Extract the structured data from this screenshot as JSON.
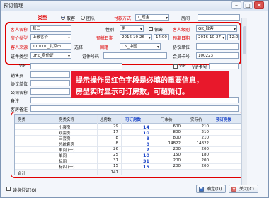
{
  "window": {
    "title": "预订管理",
    "min_label": "–",
    "max_label": "□",
    "close_label": "✕"
  },
  "form": {
    "type_label": "类型",
    "type_opt1": "散客",
    "type_opt2": "团队",
    "pay_label": "付款方式",
    "pay_value": "1_现金",
    "room_label": "房间",
    "room_value": "",
    "guest_name_label": "客人名称",
    "guest_name_value": "张三",
    "gender_label": "性别",
    "gender_value": "男",
    "deposit_label": "保密",
    "guest_class_label": "客人级别",
    "guest_class_value": "GK_散客",
    "guest_type_label": "房价类型",
    "guest_type_value": "上散客价",
    "arrival_label": "预抵日期",
    "arrival_value": "2016-10-26",
    "arrival_time": "14:00",
    "leave_label": "预离日期",
    "leave_value": "2016-10-27",
    "leave_time": "12:00",
    "source_label": "客人来源",
    "source_value": "110000_北京市",
    "source_choose": "选择",
    "country_label": "国籍",
    "country_value": "CN_中国",
    "agent_label": "协议单位",
    "agent_value": "",
    "idtype_label": "证件类型",
    "idtype_value": "0FZ_身份证",
    "idno_label": "证件号码",
    "idno_value": "",
    "card_label": "会员卡号",
    "card_value": "100223",
    "vip_label": "VIP",
    "vip_no_label": "VIP卡号",
    "sales_label": "销售员",
    "phone_label": "电话",
    "agent2_label": "协议单位",
    "company_label": "公司名称",
    "remark_label": "备注",
    "memo_label": "客房备注"
  },
  "banner": {
    "line1": "提示操作员红色字段是必填的重要信息，",
    "line2": "房型实时显示可订房数，可超预订。"
  },
  "grid": {
    "headers": {
      "c0": "房类",
      "c1": "房类名称",
      "c2": "总房数",
      "c3": "可订房数",
      "c4": "门市价",
      "c5": "实际价",
      "c6": "预订房数"
    },
    "rows": [
      {
        "name": "小套房",
        "total": "29",
        "avail": "14",
        "rack": "600",
        "price": "210"
      },
      {
        "name": "双套房",
        "total": "17",
        "avail": "10",
        "rack": "800",
        "price": "210"
      },
      {
        "name": "三套房",
        "total": "8",
        "avail": "8",
        "rack": "800",
        "price": "210"
      },
      {
        "name": "总统套房",
        "total": "8",
        "avail": "8",
        "rack": "14822",
        "price": "14822"
      },
      {
        "name": "单间 (一)",
        "total": "26",
        "avail": "7",
        "rack": "200",
        "price": "200"
      },
      {
        "name": "单间",
        "total": "25",
        "avail": "10",
        "rack": "150",
        "price": "180"
      },
      {
        "name": "标间",
        "total": "37",
        "avail": "31",
        "rack": "200",
        "price": "200"
      },
      {
        "name": "标四 (一)",
        "total": "15",
        "avail": "15",
        "rack": "200",
        "price": "200"
      }
    ],
    "footer_left": "合计",
    "footer_total": "147"
  },
  "footer": {
    "checkbox_label": "读身份证(Q)",
    "ok_label": "确定(O)",
    "cancel_label": "关闭(C)"
  },
  "colors": {
    "required": "#e00000",
    "accent_blue": "#1f48c9",
    "banner": "#e8182b"
  }
}
